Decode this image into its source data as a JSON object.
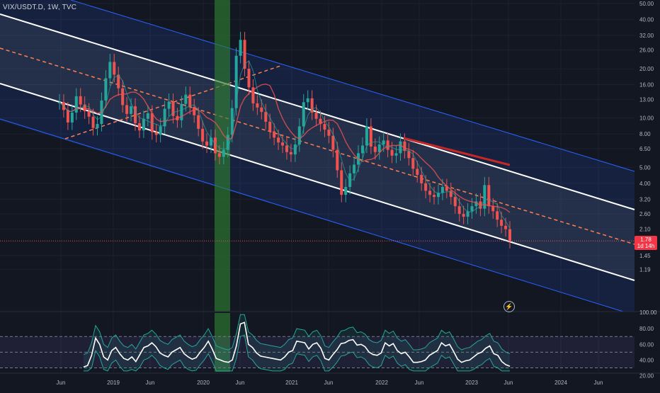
{
  "header": {
    "symbol": "VIX/USDT.D, 1W, TVC"
  },
  "price_badge": {
    "price": "1.78",
    "countdown": "1d 14h"
  },
  "lightning_icon": "lightning-icon",
  "colors": {
    "background": "#131722",
    "up": "#26a69a",
    "down": "#ef5350",
    "channel_blue": "#2962ff",
    "midline": "#ff7f50",
    "highlight": "#2e7d32",
    "rsi_band": "#7e57c2",
    "ma_red": "#c62828"
  },
  "chart_data": [
    {
      "type": "line",
      "title": "",
      "scale": "log",
      "ylim": [
        1.0,
        50.0
      ],
      "y_ticks": [
        "50.00",
        "40.00",
        "32.00",
        "26.00",
        "20.00",
        "16.00",
        "13.00",
        "10.00",
        "8.00",
        "6.50",
        "5.00",
        "4.00",
        "3.20",
        "2.60",
        "2.10",
        "1.45",
        "1.19"
      ],
      "x_ticks": [
        "Jun",
        "2019",
        "Jun",
        "2020",
        "Jun",
        "2021",
        "Jun",
        "2022",
        "Jun",
        "2023",
        "Jun",
        "2024",
        "Jun"
      ],
      "current_price": 1.78,
      "series": [
        {
          "values": [
            12.5,
            11.2,
            9.4,
            10.8,
            13.6,
            12.1,
            11.0,
            10.2,
            8.7,
            9.2,
            12.8,
            17.5,
            22.0,
            18.4,
            15.2,
            12.0,
            10.6,
            11.8,
            9.3,
            8.4,
            9.9,
            10.7,
            8.2,
            7.9,
            8.9,
            11.4,
            12.6,
            10.3,
            9.7,
            12.2,
            13.9,
            11.7,
            10.4,
            8.6,
            7.2,
            6.8,
            7.6,
            6.1,
            5.8,
            6.4,
            7.9,
            11.5,
            24.0,
            30.0,
            20.0,
            15.4,
            12.3,
            11.6,
            10.9,
            9.5,
            8.3,
            7.6,
            7.1,
            6.8,
            6.2,
            6.0,
            6.9,
            8.9,
            12.5,
            13.2,
            10.8,
            9.9,
            9.2,
            8.5,
            7.8,
            6.4,
            4.8,
            3.4,
            3.8,
            4.6,
            5.2,
            6.1,
            6.8,
            8.9,
            6.7,
            6.2,
            6.9,
            7.3,
            6.4,
            5.9,
            6.1,
            7.2,
            6.3,
            5.7,
            4.9,
            4.5,
            4.0,
            3.6,
            3.4,
            3.3,
            3.5,
            3.8,
            3.6,
            3.3,
            2.9,
            2.6,
            2.5,
            2.7,
            2.9,
            3.1,
            2.8,
            3.9,
            2.9,
            2.7,
            2.4,
            2.2,
            2.1,
            1.78
          ]
        }
      ]
    },
    {
      "type": "line",
      "title": "",
      "ylim": [
        25,
        100
      ],
      "y_ticks": [
        "100.00",
        "80.00",
        "60.00",
        "40.00",
        "20.00"
      ],
      "bands": [
        30,
        50,
        70
      ],
      "series": [
        {
          "values": [
            31,
            33,
            46,
            68,
            60,
            44,
            40,
            52,
            56,
            48,
            42,
            40,
            44,
            38,
            47,
            56,
            58,
            62,
            57,
            49,
            46,
            44,
            50,
            53,
            56,
            48,
            44,
            41,
            43,
            50,
            56,
            64,
            54,
            42,
            40,
            38,
            37,
            40,
            58,
            86,
            88,
            60,
            56,
            49,
            45,
            44,
            43,
            42,
            41,
            40,
            44,
            50,
            52,
            64,
            63,
            62,
            54,
            60,
            62,
            55,
            42,
            40,
            47,
            53,
            61,
            62,
            65,
            66,
            59,
            60,
            57,
            50,
            47,
            46,
            49,
            62,
            58,
            61,
            52,
            48,
            50,
            44,
            37,
            37,
            38,
            40,
            46,
            49,
            52,
            62,
            58,
            60,
            51,
            41,
            37,
            39,
            40,
            44,
            48,
            50,
            55,
            58,
            48,
            46,
            38,
            34,
            32
          ]
        }
      ]
    }
  ]
}
